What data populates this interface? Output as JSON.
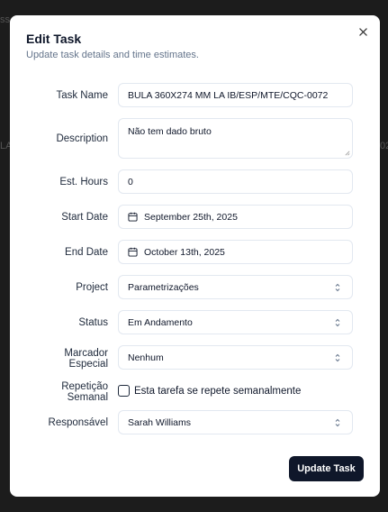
{
  "background": {
    "fragments": [
      "ss",
      "LA",
      "02"
    ]
  },
  "dialog": {
    "title": "Edit Task",
    "subtitle": "Update task details and time estimates.",
    "close_icon": "close-icon",
    "fields": {
      "task_name": {
        "label": "Task Name",
        "value": "BULA 360X274 MM LA IB/ESP/MTE/CQC-0072"
      },
      "description": {
        "label": "Description",
        "value": "Não tem dado bruto"
      },
      "est_hours": {
        "label": "Est. Hours",
        "value": "0"
      },
      "start_date": {
        "label": "Start Date",
        "value": "September 25th, 2025",
        "icon": "calendar-icon"
      },
      "end_date": {
        "label": "End Date",
        "value": "October 13th, 2025",
        "icon": "calendar-icon"
      },
      "project": {
        "label": "Project",
        "value": "Parametrizações",
        "icon": "chevron-up-down-icon"
      },
      "status": {
        "label": "Status",
        "value": "Em Andamento",
        "icon": "chevron-up-down-icon"
      },
      "marker": {
        "label_line1": "Marcador",
        "label_line2": "Especial",
        "value": "Nenhum",
        "icon": "chevron-up-down-icon"
      },
      "repeat": {
        "label_line1": "Repetição",
        "label_line2": "Semanal",
        "checkbox_label": "Esta tarefa se repete semanalmente",
        "checked": false
      },
      "assignee": {
        "label": "Responsável",
        "value": "Sarah Williams",
        "icon": "chevron-up-down-icon"
      }
    },
    "submit_label": "Update Task"
  }
}
